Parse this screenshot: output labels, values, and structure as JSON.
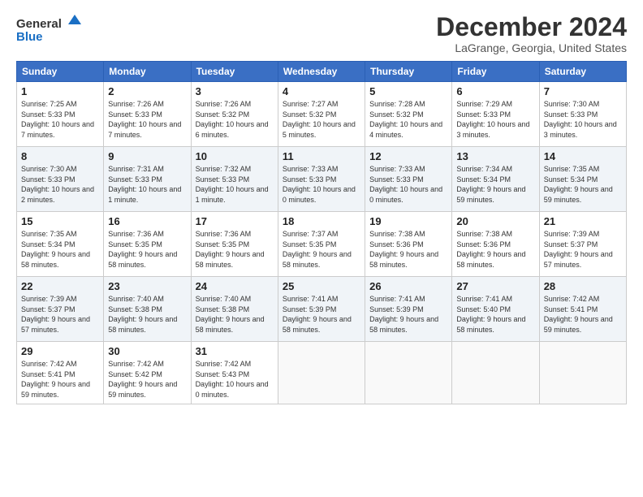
{
  "logo": {
    "line1": "General",
    "line2": "Blue"
  },
  "header": {
    "title": "December 2024",
    "subtitle": "LaGrange, Georgia, United States"
  },
  "weekdays": [
    "Sunday",
    "Monday",
    "Tuesday",
    "Wednesday",
    "Thursday",
    "Friday",
    "Saturday"
  ],
  "weeks": [
    [
      {
        "day": "1",
        "sunrise": "7:25 AM",
        "sunset": "5:33 PM",
        "daylight": "10 hours and 7 minutes."
      },
      {
        "day": "2",
        "sunrise": "7:26 AM",
        "sunset": "5:33 PM",
        "daylight": "10 hours and 7 minutes."
      },
      {
        "day": "3",
        "sunrise": "7:26 AM",
        "sunset": "5:32 PM",
        "daylight": "10 hours and 6 minutes."
      },
      {
        "day": "4",
        "sunrise": "7:27 AM",
        "sunset": "5:32 PM",
        "daylight": "10 hours and 5 minutes."
      },
      {
        "day": "5",
        "sunrise": "7:28 AM",
        "sunset": "5:32 PM",
        "daylight": "10 hours and 4 minutes."
      },
      {
        "day": "6",
        "sunrise": "7:29 AM",
        "sunset": "5:33 PM",
        "daylight": "10 hours and 3 minutes."
      },
      {
        "day": "7",
        "sunrise": "7:30 AM",
        "sunset": "5:33 PM",
        "daylight": "10 hours and 3 minutes."
      }
    ],
    [
      {
        "day": "8",
        "sunrise": "7:30 AM",
        "sunset": "5:33 PM",
        "daylight": "10 hours and 2 minutes."
      },
      {
        "day": "9",
        "sunrise": "7:31 AM",
        "sunset": "5:33 PM",
        "daylight": "10 hours and 1 minute."
      },
      {
        "day": "10",
        "sunrise": "7:32 AM",
        "sunset": "5:33 PM",
        "daylight": "10 hours and 1 minute."
      },
      {
        "day": "11",
        "sunrise": "7:33 AM",
        "sunset": "5:33 PM",
        "daylight": "10 hours and 0 minutes."
      },
      {
        "day": "12",
        "sunrise": "7:33 AM",
        "sunset": "5:33 PM",
        "daylight": "10 hours and 0 minutes."
      },
      {
        "day": "13",
        "sunrise": "7:34 AM",
        "sunset": "5:34 PM",
        "daylight": "9 hours and 59 minutes."
      },
      {
        "day": "14",
        "sunrise": "7:35 AM",
        "sunset": "5:34 PM",
        "daylight": "9 hours and 59 minutes."
      }
    ],
    [
      {
        "day": "15",
        "sunrise": "7:35 AM",
        "sunset": "5:34 PM",
        "daylight": "9 hours and 58 minutes."
      },
      {
        "day": "16",
        "sunrise": "7:36 AM",
        "sunset": "5:35 PM",
        "daylight": "9 hours and 58 minutes."
      },
      {
        "day": "17",
        "sunrise": "7:36 AM",
        "sunset": "5:35 PM",
        "daylight": "9 hours and 58 minutes."
      },
      {
        "day": "18",
        "sunrise": "7:37 AM",
        "sunset": "5:35 PM",
        "daylight": "9 hours and 58 minutes."
      },
      {
        "day": "19",
        "sunrise": "7:38 AM",
        "sunset": "5:36 PM",
        "daylight": "9 hours and 58 minutes."
      },
      {
        "day": "20",
        "sunrise": "7:38 AM",
        "sunset": "5:36 PM",
        "daylight": "9 hours and 58 minutes."
      },
      {
        "day": "21",
        "sunrise": "7:39 AM",
        "sunset": "5:37 PM",
        "daylight": "9 hours and 57 minutes."
      }
    ],
    [
      {
        "day": "22",
        "sunrise": "7:39 AM",
        "sunset": "5:37 PM",
        "daylight": "9 hours and 57 minutes."
      },
      {
        "day": "23",
        "sunrise": "7:40 AM",
        "sunset": "5:38 PM",
        "daylight": "9 hours and 58 minutes."
      },
      {
        "day": "24",
        "sunrise": "7:40 AM",
        "sunset": "5:38 PM",
        "daylight": "9 hours and 58 minutes."
      },
      {
        "day": "25",
        "sunrise": "7:41 AM",
        "sunset": "5:39 PM",
        "daylight": "9 hours and 58 minutes."
      },
      {
        "day": "26",
        "sunrise": "7:41 AM",
        "sunset": "5:39 PM",
        "daylight": "9 hours and 58 minutes."
      },
      {
        "day": "27",
        "sunrise": "7:41 AM",
        "sunset": "5:40 PM",
        "daylight": "9 hours and 58 minutes."
      },
      {
        "day": "28",
        "sunrise": "7:42 AM",
        "sunset": "5:41 PM",
        "daylight": "9 hours and 59 minutes."
      }
    ],
    [
      {
        "day": "29",
        "sunrise": "7:42 AM",
        "sunset": "5:41 PM",
        "daylight": "9 hours and 59 minutes."
      },
      {
        "day": "30",
        "sunrise": "7:42 AM",
        "sunset": "5:42 PM",
        "daylight": "9 hours and 59 minutes."
      },
      {
        "day": "31",
        "sunrise": "7:42 AM",
        "sunset": "5:43 PM",
        "daylight": "10 hours and 0 minutes."
      },
      null,
      null,
      null,
      null
    ]
  ]
}
